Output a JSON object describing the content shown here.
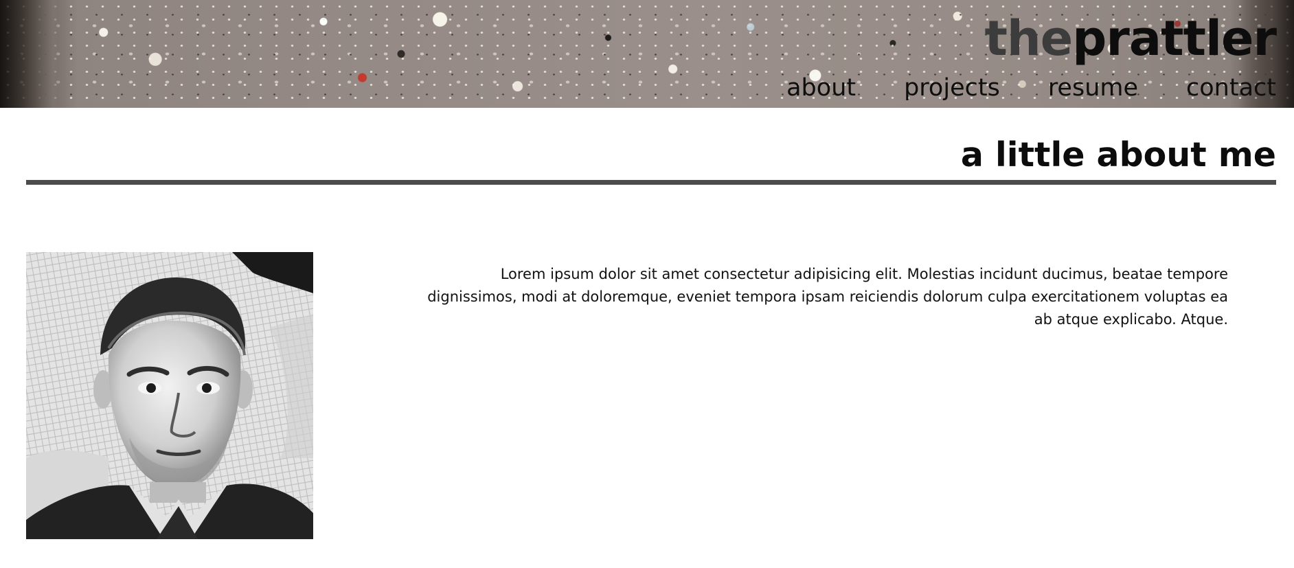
{
  "header": {
    "title_part_a": "the",
    "title_part_b": "prattler",
    "nav": [
      {
        "label": "about"
      },
      {
        "label": "projects"
      },
      {
        "label": "resume"
      },
      {
        "label": "contact"
      }
    ]
  },
  "main": {
    "heading": "a little about me",
    "intro_text": "Lorem ipsum dolor sit amet consectetur adipisicing elit. Molestias incidunt ducimus, beatae tempore dignissimos, modi at doloremque, eveniet tempora ipsam reiciendis dolorum culpa exercitationem voluptas ea ab atque explicabo. Atque."
  },
  "colors": {
    "title_part_a": "#3c3c3c",
    "title_part_b": "#0d0d0d",
    "rule": "#4c4c4c",
    "background": "#ffffff"
  },
  "icons": {
    "portrait": "person-photo"
  }
}
